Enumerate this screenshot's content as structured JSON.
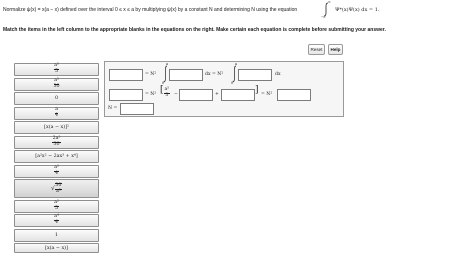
{
  "intro": {
    "text1": "Normalize ψ(x) = x(a − x) defined over the interval 0 ≤ x ≤ a by multiplying ψ(x) by a constant N and determining N using the equation",
    "lower_limit": "−∞",
    "upper_limit": "∞",
    "text2": "Ψ*(x)Ψ(x) dx = 1."
  },
  "instructions": "Match the items in the left column to the appropriate blanks in the equations on the right. Make certain each equation is complete before submitting your answer.",
  "buttons": {
    "reset": "Reset",
    "help": "Help"
  },
  "tiles": [
    {
      "type": "frac",
      "num": "a⁵",
      "den": "5"
    },
    {
      "type": "frac",
      "num": "a⁵",
      "den": "30"
    },
    {
      "type": "text",
      "text": "0"
    },
    {
      "type": "frac",
      "num": "a",
      "den": "4"
    },
    {
      "type": "text",
      "text": "[x(a − x)]²"
    },
    {
      "type": "frac",
      "num": "2a⁵",
      "den": "30"
    },
    {
      "type": "text",
      "text": "[a²x² − 2ax³ + x⁴]"
    },
    {
      "type": "frac",
      "num": "a²",
      "den": "4"
    },
    {
      "type": "sqrt",
      "num": "30",
      "den": "a⁵"
    },
    {
      "type": "frac",
      "num": "a²",
      "den": "5"
    },
    {
      "type": "frac",
      "num": "a⁴",
      "den": "4"
    },
    {
      "type": "text",
      "text": "1"
    },
    {
      "type": "text",
      "text": "[x(a − x)]"
    }
  ],
  "equation": {
    "eq1_mid": "= N²",
    "eq1_var": "dx = N²",
    "eq1_end": "dx",
    "lim_lower": "0",
    "lim_upper": "a",
    "eq2_eq": "= N²",
    "frac_num": "a⁵",
    "frac_den": "3",
    "minus": "−",
    "plus": "+",
    "eq2_end": "= N²",
    "n_label": "N ="
  }
}
